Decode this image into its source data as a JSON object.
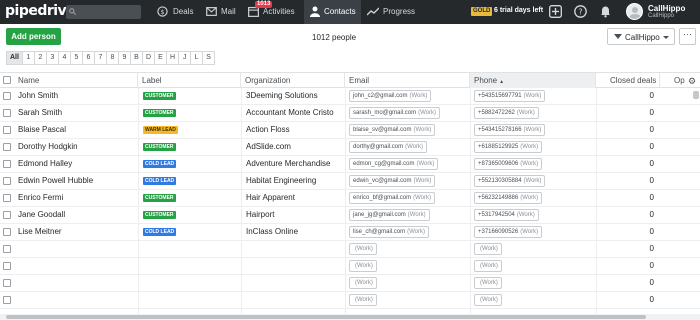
{
  "topbar": {
    "logo": "pipedrive",
    "nav": [
      {
        "label": "Deals"
      },
      {
        "label": "Mail"
      },
      {
        "label": "Activities",
        "badge": "1013"
      },
      {
        "label": "Contacts"
      },
      {
        "label": "Progress"
      }
    ],
    "plan": "GOLD",
    "trial": "6 trial days left",
    "user_name": "CallHippo",
    "user_company": "CallHippo"
  },
  "toolbar": {
    "add_label": "Add person",
    "count": "1012 people",
    "filter_label": "CallHippo",
    "more_label": "···"
  },
  "alphabet": [
    "All",
    "1",
    "2",
    "3",
    "4",
    "5",
    "6",
    "7",
    "8",
    "9",
    "B",
    "D",
    "E",
    "H",
    "J",
    "L",
    "S"
  ],
  "columns": {
    "name": "Name",
    "label": "Label",
    "organization": "Organization",
    "email": "Email",
    "phone": "Phone",
    "deals": "Closed deals",
    "extra": "Op"
  },
  "work_tag": "(Work)",
  "rows": [
    {
      "name": "John Smith",
      "label": "CUSTOMER",
      "label_color": "#25a244",
      "org": "3Deeming Solutions",
      "email": "john_c2@gmail.com",
      "phone": "+543515697791",
      "deals": "0"
    },
    {
      "name": "Sarah Smith",
      "label": "CUSTOMER",
      "label_color": "#25a244",
      "org": "Accountant Monte Cristo",
      "email": "sarash_mo@gmail.com",
      "phone": "+5882472262",
      "deals": "0"
    },
    {
      "name": "Blaise Pascal",
      "label": "WARM LEAD",
      "label_color": "#f5b927",
      "org": "Action Floss",
      "email": "blaise_sv@gmail.com",
      "phone": "+543415278166",
      "deals": "0"
    },
    {
      "name": "Dorothy Hodgkin",
      "label": "CUSTOMER",
      "label_color": "#25a244",
      "org": "AdSlide.com",
      "email": "dorthy@gmail.com",
      "phone": "+61885129925",
      "deals": "0"
    },
    {
      "name": "Edmond Halley",
      "label": "COLD LEAD",
      "label_color": "#317ae2",
      "org": "Adventure Merchandise",
      "email": "edmon_cg@gmail.com",
      "phone": "+87365009606",
      "deals": "0"
    },
    {
      "name": "Edwin Powell Hubble",
      "label": "COLD LEAD",
      "label_color": "#317ae2",
      "org": "Habitat Engineering",
      "email": "edwin_vc@gmail.com",
      "phone": "+552130305884",
      "deals": "0"
    },
    {
      "name": "Enrico Fermi",
      "label": "CUSTOMER",
      "label_color": "#25a244",
      "org": "Hair Apparent",
      "email": "enrico_bf@gmail.com",
      "phone": "+56232149886",
      "deals": "0"
    },
    {
      "name": "Jane Goodall",
      "label": "CUSTOMER",
      "label_color": "#25a244",
      "org": "Hairport",
      "email": "jane_jg@gmail.com",
      "phone": "+5317942504",
      "deals": "0"
    },
    {
      "name": "Lise Meitner",
      "label": "COLD LEAD",
      "label_color": "#317ae2",
      "org": "InClass Online",
      "email": "lise_ch@gmail.com",
      "phone": "+37166090526",
      "deals": "0"
    },
    {
      "name": "",
      "label": "",
      "label_color": "",
      "org": "",
      "email": "",
      "phone": "",
      "deals": "0"
    },
    {
      "name": "",
      "label": "",
      "label_color": "",
      "org": "",
      "email": "",
      "phone": "",
      "deals": "0"
    },
    {
      "name": "",
      "label": "",
      "label_color": "",
      "org": "",
      "email": "",
      "phone": "",
      "deals": "0"
    },
    {
      "name": "",
      "label": "",
      "label_color": "",
      "org": "",
      "email": "",
      "phone": "",
      "deals": "0"
    }
  ],
  "colors": {
    "topbar": "#26292c",
    "accent_green": "#25a244",
    "badge_red": "#e8384f",
    "gold": "#e8b93c"
  }
}
